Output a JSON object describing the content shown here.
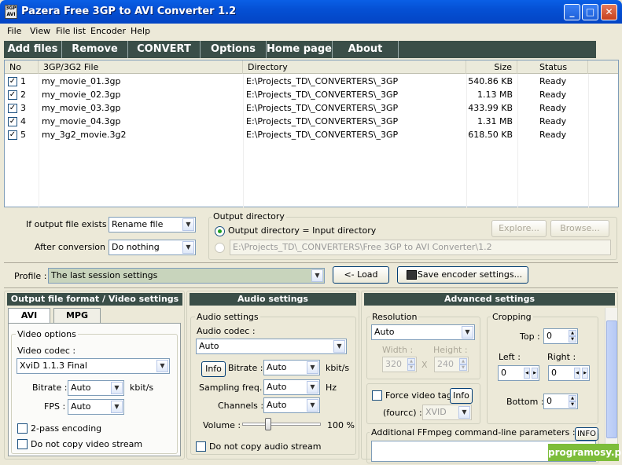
{
  "window": {
    "title": "Pazera Free 3GP to AVI Converter 1.2",
    "icon_text": "3GP AVI",
    "minimize": "_",
    "maximize": "□",
    "close": "✕"
  },
  "menu": [
    "File",
    "View",
    "File list",
    "Encoder",
    "Help"
  ],
  "toolbar": [
    "Add files",
    "Remove",
    "CONVERT",
    "Options",
    "Home page",
    "About"
  ],
  "list": {
    "headers": [
      "No",
      "3GP/3G2 File",
      "Directory",
      "Size",
      "Status"
    ],
    "rows": [
      {
        "no": "1",
        "file": "my_movie_01.3gp",
        "dir": "E:\\Projects_TD\\_CONVERTERS\\_3GP",
        "size": "540.86 KB",
        "status": "Ready",
        "checked": true
      },
      {
        "no": "2",
        "file": "my_movie_02.3gp",
        "dir": "E:\\Projects_TD\\_CONVERTERS\\_3GP",
        "size": "1.13 MB",
        "status": "Ready",
        "checked": true
      },
      {
        "no": "3",
        "file": "my_movie_03.3gp",
        "dir": "E:\\Projects_TD\\_CONVERTERS\\_3GP",
        "size": "433.99 KB",
        "status": "Ready",
        "checked": true
      },
      {
        "no": "4",
        "file": "my_movie_04.3gp",
        "dir": "E:\\Projects_TD\\_CONVERTERS\\_3GP",
        "size": "1.31 MB",
        "status": "Ready",
        "checked": true
      },
      {
        "no": "5",
        "file": "my_3g2_movie.3g2",
        "dir": "E:\\Projects_TD\\_CONVERTERS\\_3GP",
        "size": "618.50 KB",
        "status": "Ready",
        "checked": true
      }
    ]
  },
  "output": {
    "if_exists_label": "If output file exists :",
    "if_exists_value": "Rename file",
    "after_label": "After conversion :",
    "after_value": "Do nothing",
    "dir_group": "Output directory",
    "radio_same": "Output directory = Input directory",
    "explore": "Explore...",
    "browse": "Browse...",
    "path": "E:\\Projects_TD\\_CONVERTERS\\Free 3GP to AVI Converter\\1.2"
  },
  "profile": {
    "label": "Profile :",
    "value": "The last session settings",
    "load": "<- Load",
    "save": "Save encoder settings..."
  },
  "video": {
    "head": "Output file format / Video settings",
    "tab_avi": "AVI",
    "tab_mpg": "MPG",
    "group": "Video options",
    "codec_label": "Video codec :",
    "codec_value": "XviD 1.1.3 Final",
    "bitrate_label": "Bitrate :",
    "bitrate_value": "Auto",
    "bitrate_unit": "kbit/s",
    "fps_label": "FPS :",
    "fps_value": "Auto",
    "twopass": "2-pass encoding",
    "nocopy": "Do not copy video stream"
  },
  "audio": {
    "head": "Audio settings",
    "group": "Audio settings",
    "codec_label": "Audio codec :",
    "codec_value": "Auto",
    "info": "Info",
    "bitrate_label": "Bitrate :",
    "bitrate_value": "Auto",
    "bitrate_unit": "kbit/s",
    "freq_label": "Sampling freq. :",
    "freq_value": "Auto",
    "freq_unit": "Hz",
    "channels_label": "Channels :",
    "channels_value": "Auto",
    "volume_label": "Volume :",
    "volume_value": "100 %",
    "volume_level": 0.33,
    "nocopy": "Do not copy audio stream"
  },
  "advanced": {
    "head": "Advanced settings",
    "res_group": "Resolution",
    "res_value": "Auto",
    "width_label": "Width :",
    "width_value": "320",
    "height_label": "Height :",
    "height_value": "240",
    "x": "X",
    "crop_group": "Cropping",
    "top_label": "Top :",
    "top_value": "0",
    "left_label": "Left :",
    "left_value": "0",
    "right_label": "Right :",
    "right_value": "0",
    "bottom_label": "Bottom :",
    "bottom_value": "0",
    "force_label": "Force video tag",
    "info": "Info",
    "fourcc_label": "(fourcc) :",
    "fourcc_value": "XVID",
    "ffmpeg_label": "Additional FFmpeg command-line parameters :",
    "ffmpeg_info": "INFO"
  },
  "watermark": "programosy.pl"
}
